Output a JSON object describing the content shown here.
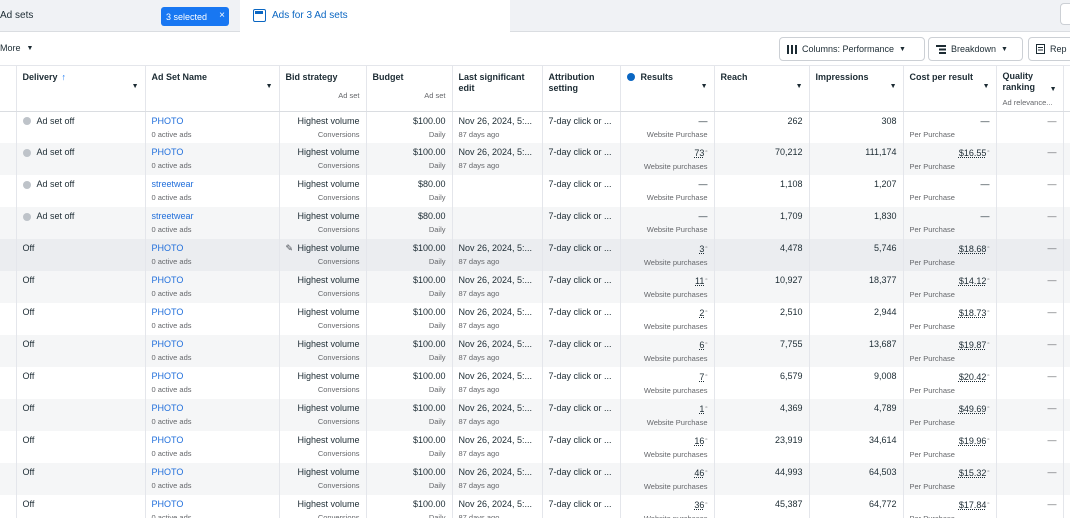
{
  "tabs": {
    "left_title": "Ad sets",
    "selected_label": "3 selected",
    "close_glyph": "×",
    "active_label": "Ads for 3 Ad sets"
  },
  "toolbar": {
    "more_label": "More",
    "columns_label": "Columns: Performance",
    "breakdown_label": "Breakdown",
    "reports_label": "Rep"
  },
  "headers": {
    "delivery": "Delivery",
    "name": "Ad Set Name",
    "bid": "Bid strategy",
    "bid_sub": "Ad set",
    "budget": "Budget",
    "budget_sub": "Ad set",
    "last_edit": "Last significant edit",
    "attribution": "Attribution setting",
    "results": "Results",
    "reach": "Reach",
    "impressions": "Impressions",
    "cpr": "Cost per result",
    "quality": "Quality ranking",
    "quality_sub": "Ad relevance..."
  },
  "rows": [
    {
      "delivery": "Ad set off",
      "name": "PHOTO",
      "ads": "0 active ads",
      "bid": "Highest volume",
      "bid_sub": "Conversions",
      "budget": "$100.00",
      "budget_sub": "Daily",
      "edit": "Nov 26, 2024, 5:...",
      "edit_sub": "87 days ago",
      "attr": "7-day click or ...",
      "result": "—",
      "result_sub": "Website Purchase",
      "reach": "262",
      "impr": "308",
      "cpr": "—",
      "cpr_sub": "Per Purchase",
      "q": "—"
    },
    {
      "delivery": "Ad set off",
      "name": "PHOTO",
      "ads": "0 active ads",
      "bid": "Highest volume",
      "bid_sub": "Conversions",
      "budget": "$100.00",
      "budget_sub": "Daily",
      "edit": "Nov 26, 2024, 5:...",
      "edit_sub": "87 days ago",
      "attr": "7-day click or ...",
      "result": "73",
      "result_sub": "Website purchases",
      "reach": "70,212",
      "impr": "111,174",
      "cpr": "$16.55",
      "cpr_sub": "Per Purchase",
      "q": "—"
    },
    {
      "delivery": "Ad set off",
      "name": "streetwear",
      "ads": "0 active ads",
      "bid": "Highest volume",
      "bid_sub": "Conversions",
      "budget": "$80.00",
      "budget_sub": "Daily",
      "edit": "",
      "edit_sub": "",
      "attr": "7-day click or ...",
      "result": "—",
      "result_sub": "Website Purchase",
      "reach": "1,108",
      "impr": "1,207",
      "cpr": "—",
      "cpr_sub": "Per Purchase",
      "q": "—"
    },
    {
      "delivery": "Ad set off",
      "name": "streetwear",
      "ads": "0 active ads",
      "bid": "Highest volume",
      "bid_sub": "Conversions",
      "budget": "$80.00",
      "budget_sub": "Daily",
      "edit": "",
      "edit_sub": "",
      "attr": "7-day click or ...",
      "result": "—",
      "result_sub": "Website Purchase",
      "reach": "1,709",
      "impr": "1,830",
      "cpr": "—",
      "cpr_sub": "Per Purchase",
      "q": "—"
    },
    {
      "delivery": "Off",
      "name": "PHOTO",
      "ads": "0 active ads",
      "bid": "Highest volume",
      "bid_sub": "Conversions",
      "budget": "$100.00",
      "budget_sub": "Daily",
      "edit": "Nov 26, 2024, 5:...",
      "edit_sub": "87 days ago",
      "attr": "7-day click or ...",
      "result": "3",
      "result_sub": "Website purchases",
      "reach": "4,478",
      "impr": "5,746",
      "cpr": "$18.68",
      "cpr_sub": "Per Purchase",
      "q": "—"
    },
    {
      "delivery": "Off",
      "name": "PHOTO",
      "ads": "0 active ads",
      "bid": "Highest volume",
      "bid_sub": "Conversions",
      "budget": "$100.00",
      "budget_sub": "Daily",
      "edit": "Nov 26, 2024, 5:...",
      "edit_sub": "87 days ago",
      "attr": "7-day click or ...",
      "result": "11",
      "result_sub": "Website purchases",
      "reach": "10,927",
      "impr": "18,377",
      "cpr": "$14.12",
      "cpr_sub": "Per Purchase",
      "q": "—"
    },
    {
      "delivery": "Off",
      "name": "PHOTO",
      "ads": "0 active ads",
      "bid": "Highest volume",
      "bid_sub": "Conversions",
      "budget": "$100.00",
      "budget_sub": "Daily",
      "edit": "Nov 26, 2024, 5:...",
      "edit_sub": "87 days ago",
      "attr": "7-day click or ...",
      "result": "2",
      "result_sub": "Website purchases",
      "reach": "2,510",
      "impr": "2,944",
      "cpr": "$18.73",
      "cpr_sub": "Per Purchase",
      "q": "—"
    },
    {
      "delivery": "Off",
      "name": "PHOTO",
      "ads": "0 active ads",
      "bid": "Highest volume",
      "bid_sub": "Conversions",
      "budget": "$100.00",
      "budget_sub": "Daily",
      "edit": "Nov 26, 2024, 5:...",
      "edit_sub": "87 days ago",
      "attr": "7-day click or ...",
      "result": "6",
      "result_sub": "Website purchases",
      "reach": "7,755",
      "impr": "13,687",
      "cpr": "$19.87",
      "cpr_sub": "Per Purchase",
      "q": "—"
    },
    {
      "delivery": "Off",
      "name": "PHOTO",
      "ads": "0 active ads",
      "bid": "Highest volume",
      "bid_sub": "Conversions",
      "budget": "$100.00",
      "budget_sub": "Daily",
      "edit": "Nov 26, 2024, 5:...",
      "edit_sub": "87 days ago",
      "attr": "7-day click or ...",
      "result": "7",
      "result_sub": "Website purchases",
      "reach": "6,579",
      "impr": "9,008",
      "cpr": "$20.42",
      "cpr_sub": "Per Purchase",
      "q": "—"
    },
    {
      "delivery": "Off",
      "name": "PHOTO",
      "ads": "0 active ads",
      "bid": "Highest volume",
      "bid_sub": "Conversions",
      "budget": "$100.00",
      "budget_sub": "Daily",
      "edit": "Nov 26, 2024, 5:...",
      "edit_sub": "87 days ago",
      "attr": "7-day click or ...",
      "result": "1",
      "result_sub": "Website Purchase",
      "reach": "4,369",
      "impr": "4,789",
      "cpr": "$49.69",
      "cpr_sub": "Per Purchase",
      "q": "—"
    },
    {
      "delivery": "Off",
      "name": "PHOTO",
      "ads": "0 active ads",
      "bid": "Highest volume",
      "bid_sub": "Conversions",
      "budget": "$100.00",
      "budget_sub": "Daily",
      "edit": "Nov 26, 2024, 5:...",
      "edit_sub": "87 days ago",
      "attr": "7-day click or ...",
      "result": "16",
      "result_sub": "Website purchases",
      "reach": "23,919",
      "impr": "34,614",
      "cpr": "$19.96",
      "cpr_sub": "Per Purchase",
      "q": "—"
    },
    {
      "delivery": "Off",
      "name": "PHOTO",
      "ads": "0 active ads",
      "bid": "Highest volume",
      "bid_sub": "Conversions",
      "budget": "$100.00",
      "budget_sub": "Daily",
      "edit": "Nov 26, 2024, 5:...",
      "edit_sub": "87 days ago",
      "attr": "7-day click or ...",
      "result": "46",
      "result_sub": "Website purchases",
      "reach": "44,993",
      "impr": "64,503",
      "cpr": "$15.32",
      "cpr_sub": "Per Purchase",
      "q": "—"
    },
    {
      "delivery": "Off",
      "name": "PHOTO",
      "ads": "0 active ads",
      "bid": "Highest volume",
      "bid_sub": "Conversions",
      "budget": "$100.00",
      "budget_sub": "Daily",
      "edit": "Nov 26, 2024, 5:...",
      "edit_sub": "87 days ago",
      "attr": "7-day click or ...",
      "result": "36",
      "result_sub": "Website purchases",
      "reach": "45,387",
      "impr": "64,772",
      "cpr": "$17.84",
      "cpr_sub": "Per Purchase",
      "q": "—"
    }
  ],
  "icons": {
    "info": "info-icon",
    "columns": "columns-icon",
    "breakdown": "breakdown-icon",
    "reports": "reports-icon",
    "pencil": "pencil-icon"
  },
  "colors": {
    "accent": "#1877f2",
    "link": "#216fdb",
    "row_alt": "#f5f6f7"
  }
}
